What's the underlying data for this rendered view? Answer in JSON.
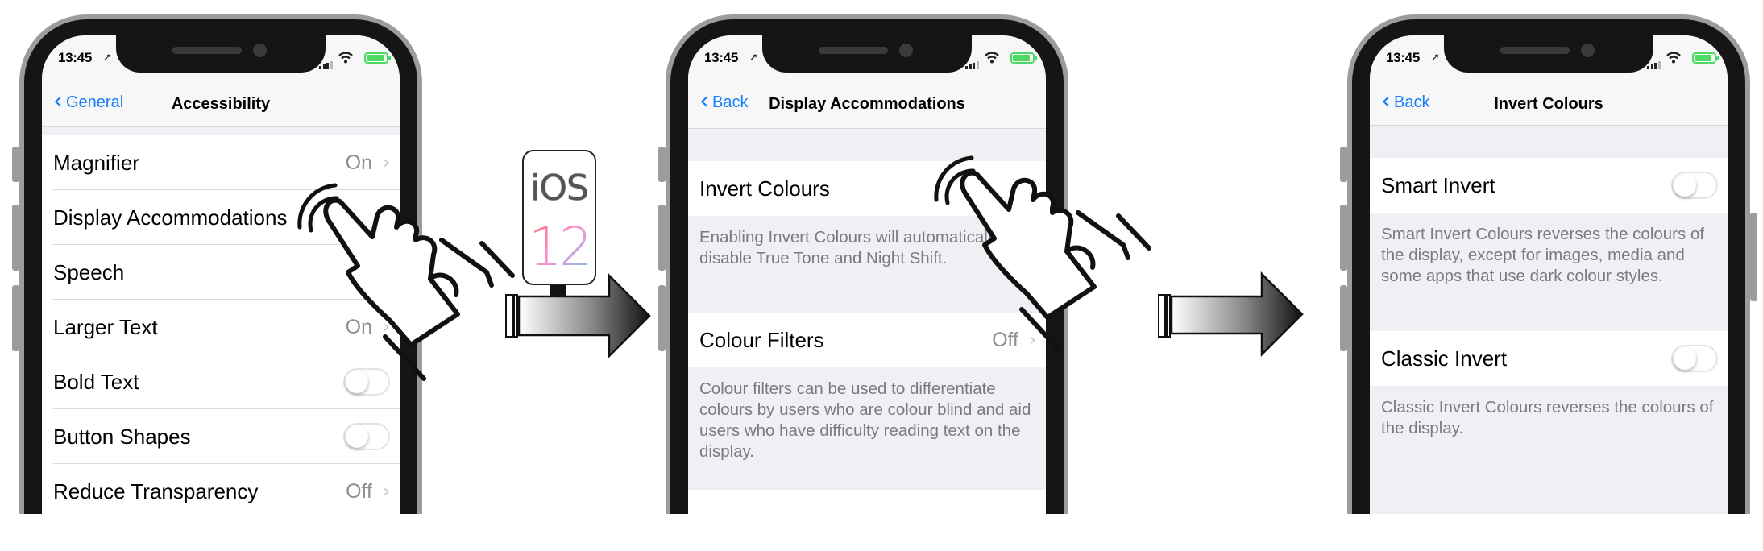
{
  "colors": {
    "accent": "#147efb",
    "secondary_text": "#8e8e93",
    "battery": "#4cd964",
    "arrow_dark": "#111111"
  },
  "badge": {
    "os_label": "iOS",
    "version": "12"
  },
  "phones": [
    {
      "time": "13:45",
      "back_label": "General",
      "title": "Accessibility",
      "rows": [
        {
          "label": "Magnifier",
          "value": "On"
        },
        {
          "label": "Display Accommodations",
          "value": ""
        },
        {
          "label": "Speech",
          "value": ""
        },
        {
          "label": "Larger Text",
          "value": "On"
        },
        {
          "label": "Bold Text",
          "toggle": "off"
        },
        {
          "label": "Button Shapes",
          "toggle": "off"
        },
        {
          "label": "Reduce Transparency",
          "value": "Off"
        }
      ]
    },
    {
      "time": "13:45",
      "back_label": "Back",
      "title": "Display Accommodations",
      "rows": [
        {
          "label": "Invert Colours",
          "value": ""
        },
        {
          "label": "Colour Filters",
          "value": "Off"
        }
      ],
      "footers": [
        "Enabling Invert Colours will automatically disable True Tone and Night Shift.",
        "Colour filters can be used to differentiate colours by users who are colour blind and aid users who have difficulty reading text on the display."
      ]
    },
    {
      "time": "13:45",
      "back_label": "Back",
      "title": "Invert Colours",
      "rows": [
        {
          "label": "Smart Invert",
          "toggle": "off"
        },
        {
          "label": "Classic Invert",
          "toggle": "off"
        }
      ],
      "footers": [
        "Smart Invert Colours reverses the colours of the display, except for images, media and some apps that use dark colour styles.",
        "Classic Invert Colours reverses the colours of the display."
      ]
    }
  ]
}
